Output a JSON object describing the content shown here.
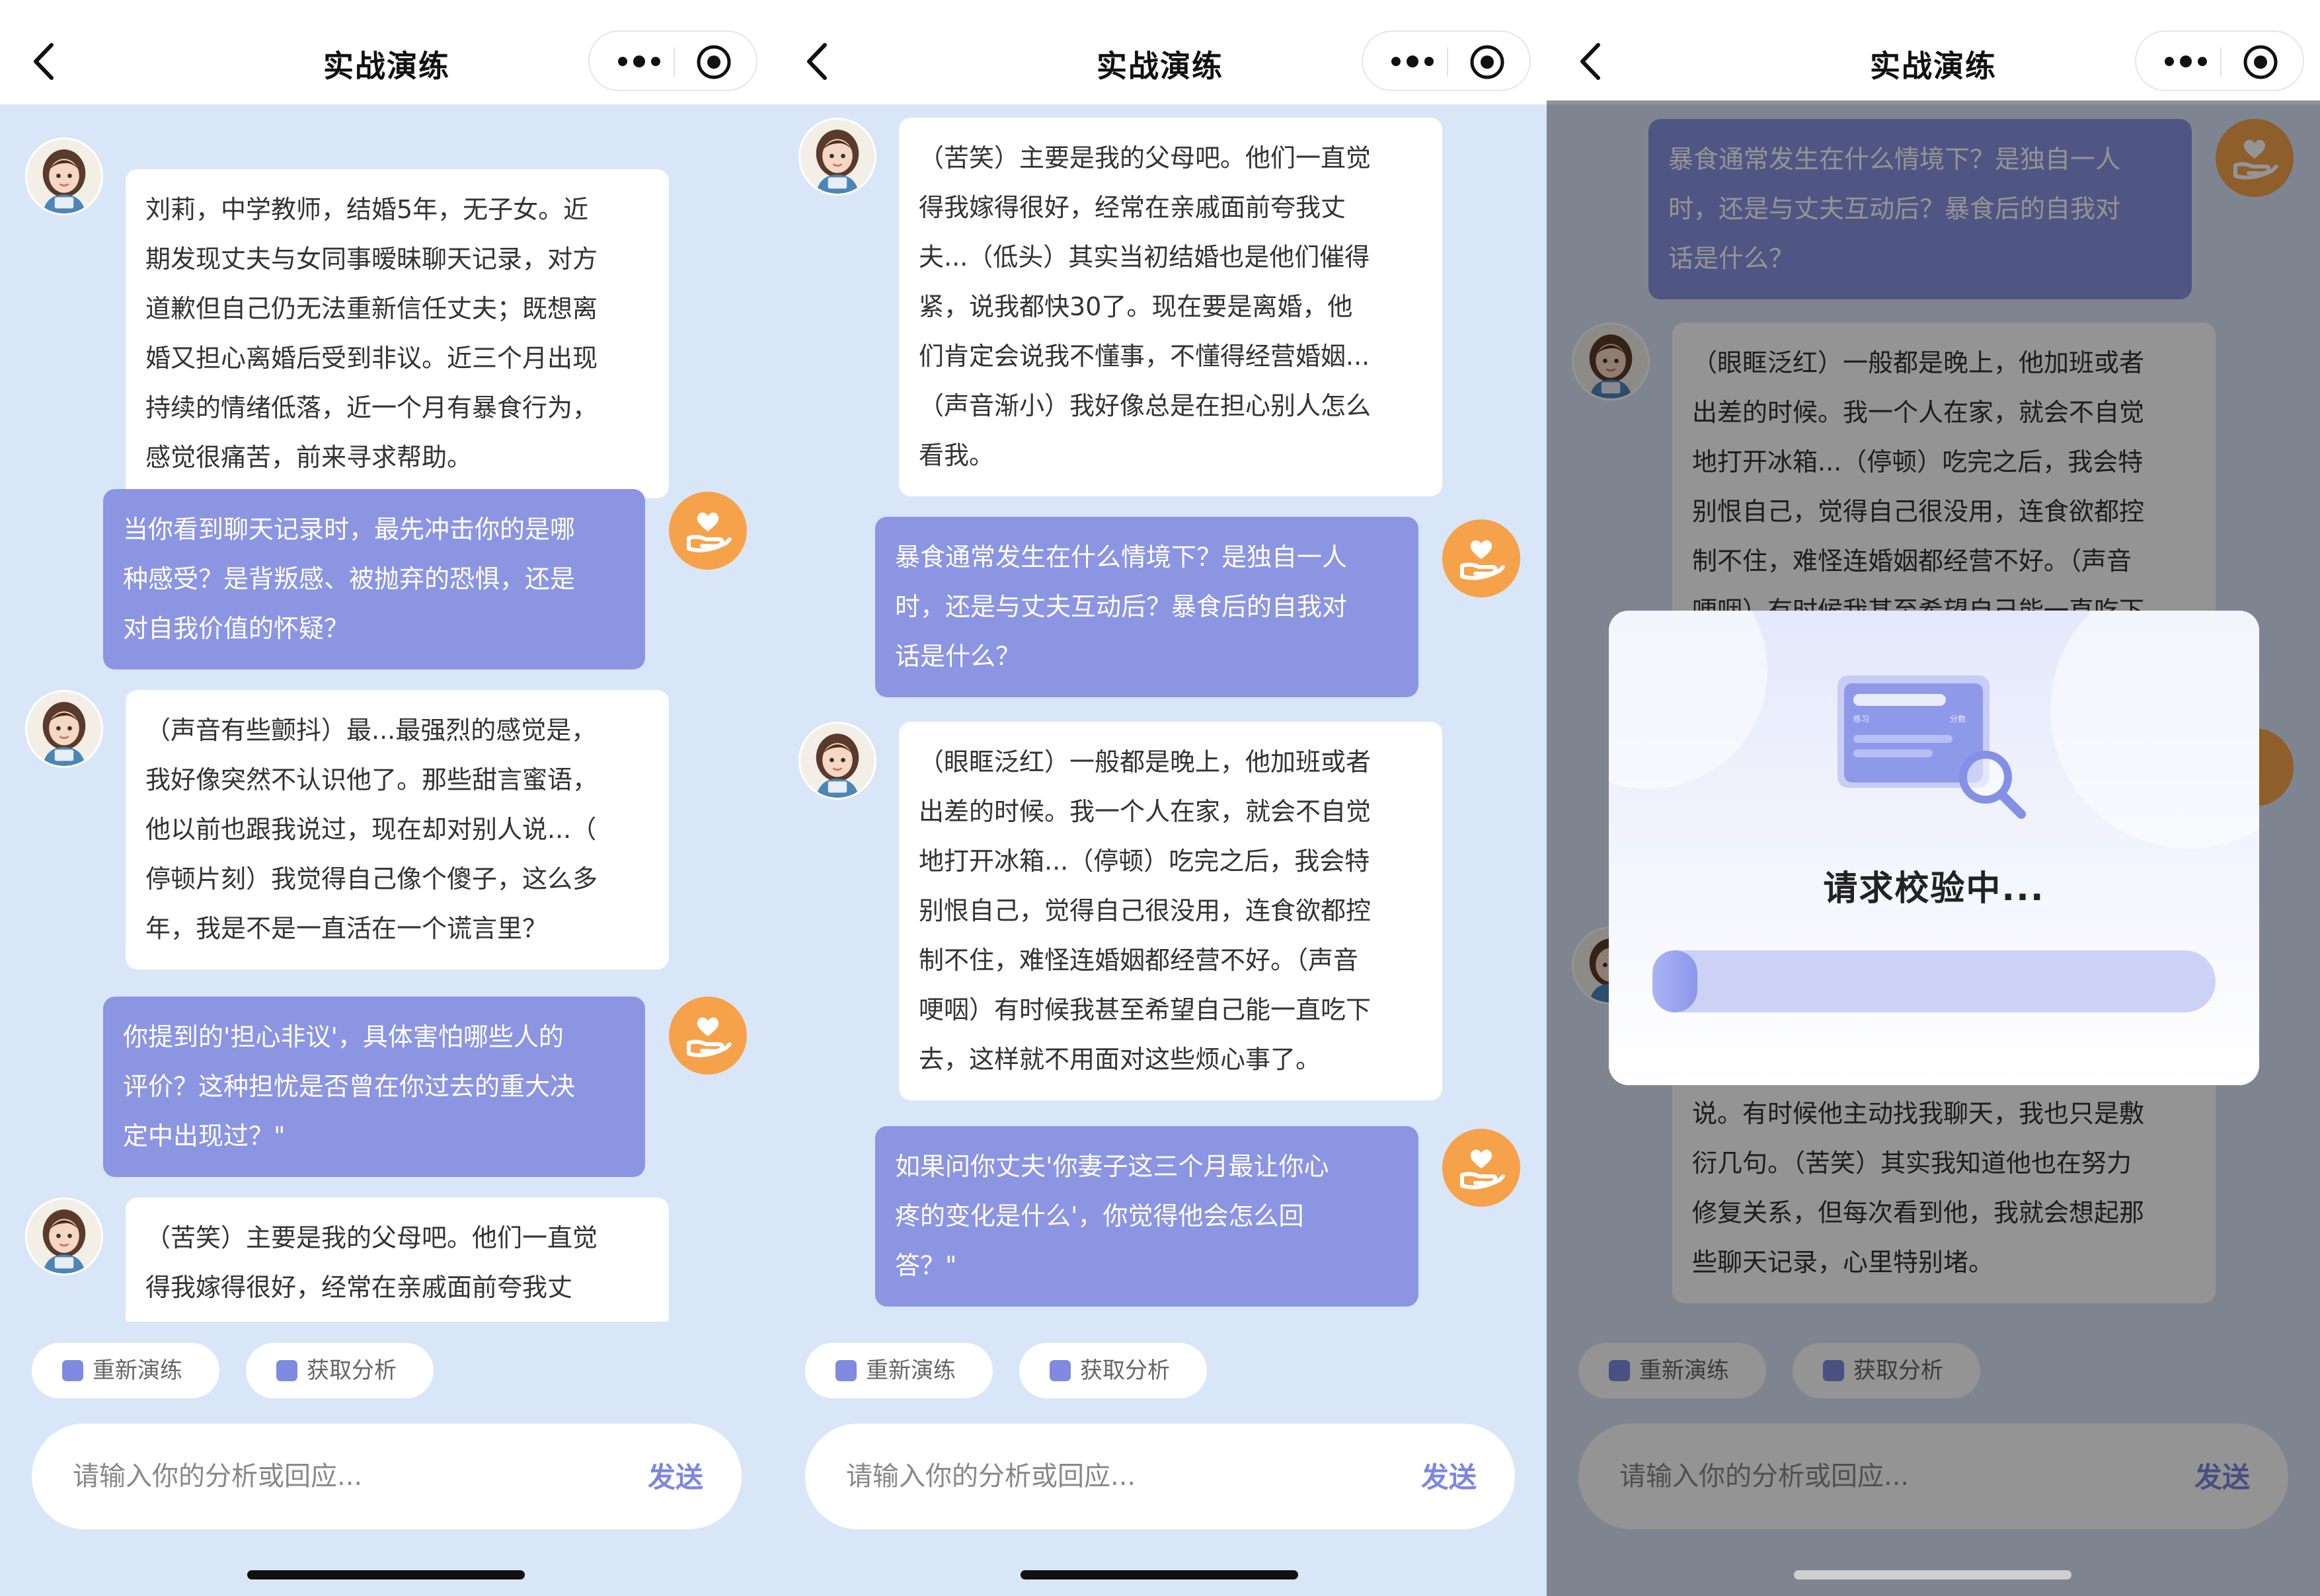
{
  "nav": {
    "title": "实战演练"
  },
  "actions": {
    "retrain": "重新演练",
    "analysis": "获取分析"
  },
  "input": {
    "placeholder": "请输入你的分析或回应...",
    "send": "发送"
  },
  "panel1": {
    "messages": [
      {
        "role": "client",
        "text": "刘莉，中学教师，结婚5年，无子女。近\n期发现丈夫与女同事暧昧聊天记录，对方\n道歉但自己仍无法重新信任丈夫；既想离\n婚又担心离婚后受到非议。近三个月出现\n持续的情绪低落，近一个月有暴食行为，\n感觉很痛苦，前来寻求帮助。"
      },
      {
        "role": "counselor",
        "text": "当你看到聊天记录时，最先冲击你的是哪\n种感受？是背叛感、被抛弃的恐惧，还是\n对自我价值的怀疑？"
      },
      {
        "role": "client",
        "text": "（声音有些颤抖）最...最强烈的感觉是，\n我好像突然不认识他了。那些甜言蜜语，\n他以前也跟我说过，现在却对别人说...（\n停顿片刻）我觉得自己像个傻子，这么多\n年，我是不是一直活在一个谎言里？"
      },
      {
        "role": "counselor",
        "text": "你提到的'担心非议'，具体害怕哪些人的\n评价？这种担忧是否曾在你过去的重大决\n定中出现过？\""
      },
      {
        "role": "client",
        "text": "（苦笑）主要是我的父母吧。他们一直觉\n得我嫁得很好，经常在亲戚面前夸我丈"
      }
    ]
  },
  "panel2": {
    "messages": [
      {
        "role": "client",
        "text": "（苦笑）主要是我的父母吧。他们一直觉\n得我嫁得很好，经常在亲戚面前夸我丈\n夫...（低头）其实当初结婚也是他们催得\n紧，说我都快30了。现在要是离婚，他\n们肯定会说我不懂事，不懂得经营婚姻...\n（声音渐小）我好像总是在担心别人怎么\n看我。"
      },
      {
        "role": "counselor",
        "text": "暴食通常发生在什么情境下？是独自一人\n时，还是与丈夫互动后？暴食后的自我对\n话是什么？"
      },
      {
        "role": "client",
        "text": "（眼眶泛红）一般都是晚上，他加班或者\n出差的时候。我一个人在家，就会不自觉\n地打开冰箱...（停顿）吃完之后，我会特\n别恨自己，觉得自己很没用，连食欲都控\n制不住，难怪连婚姻都经营不好。（声音\n哽咽）有时候我甚至希望自己能一直吃下\n去，这样就不用面对这些烦心事了。"
      },
      {
        "role": "counselor",
        "text": "如果问你丈夫'你妻子这三个月最让你心\n疼的变化是什么'，你觉得他会怎么回\n答？\""
      }
    ]
  },
  "panel3": {
    "messages": [
      {
        "role": "counselor",
        "text": "暴食通常发生在什么情境下？是独自一人\n时，还是与丈夫互动后？暴食后的自我对\n话是什么？"
      },
      {
        "role": "client",
        "text": "（眼眶泛红）一般都是晚上，他加班或者\n出差的时候。我一个人在家，就会不自觉\n地打开冰箱...（停顿）吃完之后，我会特\n别恨自己，觉得自己很没用，连食欲都控\n制不住，难怪连婚姻都经营不好。（声音\n哽咽）有时候我甚至希望自己能一直吃下"
      },
      {
        "role": "client",
        "text": "说。有时候他主动找我聊天，我也只是敷\n衍几句。（苦笑）其实我知道他也在努力\n修复关系，但每次看到他，我就会想起那\n些聊天记录，心里特别堵。"
      }
    ],
    "modal": {
      "title": "请求校验中...",
      "illustration_labels": {
        "left": "练习",
        "right": "分数"
      },
      "progress": 0.08
    }
  },
  "colors": {
    "counselor_bubble": "#8b95e2",
    "client_bubble": "#ffffff",
    "background": "#d9e6f8",
    "counselor_avatar": "#f5a24b",
    "send": "#7d87de"
  }
}
